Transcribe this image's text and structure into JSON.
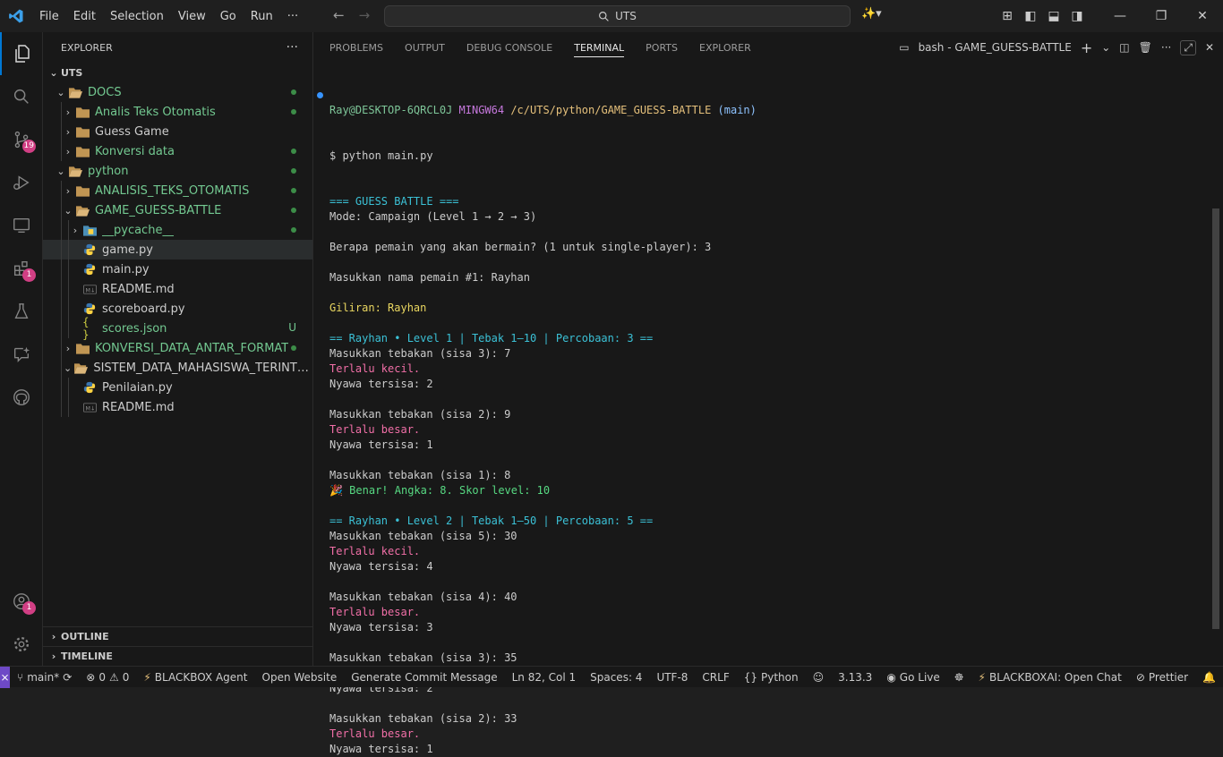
{
  "titlebar": {
    "menu": [
      "File",
      "Edit",
      "Selection",
      "View",
      "Go",
      "Run",
      "···"
    ],
    "search": "UTS"
  },
  "activity": {
    "source_control_badge": "19",
    "extensions_badge": "1",
    "accounts_badge": "1"
  },
  "sidebar": {
    "title": "EXPLORER",
    "more": "···",
    "root": "UTS",
    "items": [
      {
        "label": "DOCS",
        "depth": 1,
        "type": "folder-open",
        "color": "#73c991",
        "dot": true
      },
      {
        "label": "Analis Teks Otomatis",
        "depth": 2,
        "type": "folder",
        "color": "#73c991",
        "dot": true
      },
      {
        "label": "Guess Game",
        "depth": 2,
        "type": "folder",
        "color": "#cccccc",
        "dot": false
      },
      {
        "label": "Konversi data",
        "depth": 2,
        "type": "folder",
        "color": "#73c991",
        "dot": true
      },
      {
        "label": "python",
        "depth": 1,
        "type": "folder-open",
        "color": "#73c991",
        "dot": true
      },
      {
        "label": "ANALISIS_TEKS_OTOMATIS",
        "depth": 2,
        "type": "folder",
        "color": "#73c991",
        "dot": true
      },
      {
        "label": "GAME_GUESS-BATTLE",
        "depth": 2,
        "type": "folder-open",
        "color": "#73c991",
        "dot": true
      },
      {
        "label": "__pycache__",
        "depth": 3,
        "type": "folder-py",
        "color": "#73c991",
        "dot": true
      },
      {
        "label": "game.py",
        "depth": 3,
        "type": "py",
        "color": "#cccccc",
        "dot": false,
        "selected": true
      },
      {
        "label": "main.py",
        "depth": 3,
        "type": "py",
        "color": "#cccccc",
        "dot": false
      },
      {
        "label": "README.md",
        "depth": 3,
        "type": "md",
        "color": "#cccccc",
        "dot": false
      },
      {
        "label": "scoreboard.py",
        "depth": 3,
        "type": "py",
        "color": "#cccccc",
        "dot": false
      },
      {
        "label": "scores.json",
        "depth": 3,
        "type": "json",
        "color": "#73c991",
        "dot": false,
        "mark": "U"
      },
      {
        "label": "KONVERSI_DATA_ANTAR_FORMAT",
        "depth": 2,
        "type": "folder",
        "color": "#73c991",
        "dot": true
      },
      {
        "label": "SISTEM_DATA_MAHASISWA_TERINTEG...",
        "depth": 2,
        "type": "folder-open",
        "color": "#cccccc",
        "dot": false
      },
      {
        "label": "Penilaian.py",
        "depth": 3,
        "type": "py",
        "color": "#cccccc",
        "dot": false
      },
      {
        "label": "README.md",
        "depth": 3,
        "type": "md",
        "color": "#cccccc",
        "dot": false
      }
    ],
    "outline": "OUTLINE",
    "timeline": "TIMELINE"
  },
  "panel": {
    "tabs": [
      "PROBLEMS",
      "OUTPUT",
      "DEBUG CONSOLE",
      "TERMINAL",
      "PORTS",
      "EXPLORER"
    ],
    "active_tab": "TERMINAL",
    "terminal_name": "bash - GAME_GUESS-BATTLE"
  },
  "terminal": {
    "prompt_user": "Ray@DESKTOP-6QRCL0J",
    "prompt_env": "MINGW64",
    "prompt_path": "/c/UTS/python/GAME_GUESS-BATTLE",
    "prompt_branch": "(main)",
    "command": "$ python main.py",
    "lines": [
      {
        "t": "=== GUESS BATTLE ===",
        "c": "c-heading"
      },
      {
        "t": "Mode: Campaign (Level 1 → 2 → 3)",
        "c": ""
      },
      {
        "t": "",
        "c": ""
      },
      {
        "t": "Berapa pemain yang akan bermain? (1 untuk single-player): 3",
        "c": ""
      },
      {
        "t": "",
        "c": ""
      },
      {
        "t": "Masukkan nama pemain #1: Rayhan",
        "c": ""
      },
      {
        "t": "",
        "c": ""
      },
      {
        "t": "Giliran: Rayhan",
        "c": "c-gold"
      },
      {
        "t": "",
        "c": ""
      },
      {
        "t": "== Rayhan • Level 1 | Tebak 1–10 | Percobaan: 3 ==",
        "c": "c-heading"
      },
      {
        "t": "Masukkan tebakan (sisa 3): 7",
        "c": ""
      },
      {
        "t": "Terlalu kecil.",
        "c": "c-red"
      },
      {
        "t": "Nyawa tersisa: 2",
        "c": ""
      },
      {
        "t": "",
        "c": ""
      },
      {
        "t": "Masukkan tebakan (sisa 2): 9",
        "c": ""
      },
      {
        "t": "Terlalu besar.",
        "c": "c-red"
      },
      {
        "t": "Nyawa tersisa: 1",
        "c": ""
      },
      {
        "t": "",
        "c": ""
      },
      {
        "t": "Masukkan tebakan (sisa 1): 8",
        "c": ""
      },
      {
        "t": "🎉 Benar! Angka: 8. Skor level: 10",
        "c": "c-success"
      },
      {
        "t": "",
        "c": ""
      },
      {
        "t": "== Rayhan • Level 2 | Tebak 1–50 | Percobaan: 5 ==",
        "c": "c-heading"
      },
      {
        "t": "Masukkan tebakan (sisa 5): 30",
        "c": ""
      },
      {
        "t": "Terlalu kecil.",
        "c": "c-red"
      },
      {
        "t": "Nyawa tersisa: 4",
        "c": ""
      },
      {
        "t": "",
        "c": ""
      },
      {
        "t": "Masukkan tebakan (sisa 4): 40",
        "c": ""
      },
      {
        "t": "Terlalu besar.",
        "c": "c-red"
      },
      {
        "t": "Nyawa tersisa: 3",
        "c": ""
      },
      {
        "t": "",
        "c": ""
      },
      {
        "t": "Masukkan tebakan (sisa 3): 35",
        "c": ""
      },
      {
        "t": "Terlalu besar.",
        "c": "c-red"
      },
      {
        "t": "Nyawa tersisa: 2",
        "c": ""
      },
      {
        "t": "",
        "c": ""
      },
      {
        "t": "Masukkan tebakan (sisa 2): 33",
        "c": ""
      },
      {
        "t": "Terlalu besar.",
        "c": "c-red"
      },
      {
        "t": "Nyawa tersisa: 1",
        "c": ""
      }
    ]
  },
  "statusbar": {
    "branch": "main*",
    "errors": "0",
    "warnings": "0",
    "blackbox": "BLACKBOX Agent",
    "open_website": "Open Website",
    "commit": "Generate Commit Message",
    "position": "Ln 82, Col 1",
    "spaces": "Spaces: 4",
    "encoding": "UTF-8",
    "eol": "CRLF",
    "language": "Python",
    "version": "3.13.3",
    "golive": "Go Live",
    "blackbox_chat": "BLACKBOXAI: Open Chat",
    "prettier": "Prettier"
  }
}
